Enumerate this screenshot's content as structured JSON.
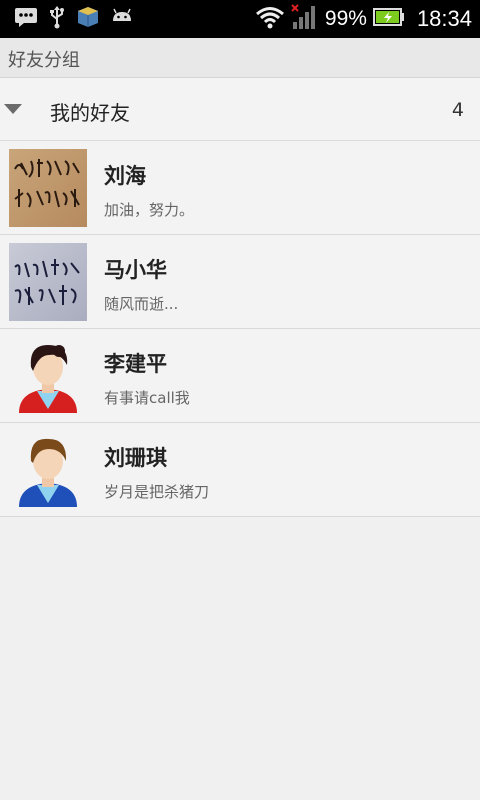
{
  "status_bar": {
    "battery_percent": "99%",
    "time": "18:34",
    "icons": [
      "message-icon",
      "usb-icon",
      "app-icon",
      "android-icon",
      "wifi-icon",
      "signal-icon",
      "battery-icon"
    ]
  },
  "title": "好友分组",
  "group": {
    "name": "我的好友",
    "count": "4",
    "expanded": true
  },
  "friends": [
    {
      "name": "刘海",
      "signature": "加油，努力。",
      "avatar": "handwriting-avatar-1"
    },
    {
      "name": "马小华",
      "signature": "随风而逝...",
      "avatar": "handwriting-avatar-2"
    },
    {
      "name": "李建平",
      "signature": "有事请call我",
      "avatar": "female-avatar"
    },
    {
      "name": "刘珊琪",
      "signature": "岁月是把杀猪刀",
      "avatar": "male-avatar"
    }
  ],
  "colors": {
    "status_bar_bg": "#000000",
    "background": "#f0f0f0",
    "battery_green": "#7ecb1f"
  }
}
